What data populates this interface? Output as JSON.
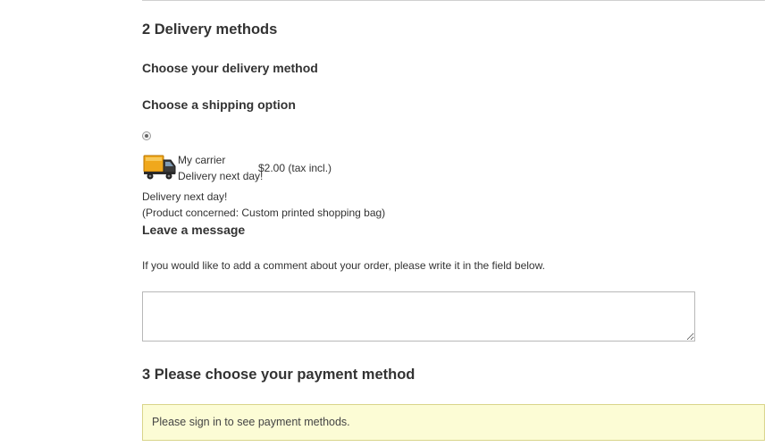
{
  "delivery": {
    "section_title": "2 Delivery methods",
    "choose_method": "Choose your delivery method",
    "choose_option": "Choose a shipping option",
    "carrier": {
      "name": "My carrier",
      "delay": "Delivery next day!",
      "price": "$2.00 (tax incl.)",
      "selected": true,
      "icon": "delivery-truck-icon"
    },
    "note_line1": "Delivery next day!",
    "note_line2": "(Product concerned: Custom printed shopping bag)"
  },
  "message": {
    "title": "Leave a message",
    "hint": "If you would like to add a comment about your order, please write it in the field below.",
    "value": ""
  },
  "payment": {
    "section_title": "3 Please choose your payment method",
    "alert": "Please sign in to see payment methods."
  }
}
